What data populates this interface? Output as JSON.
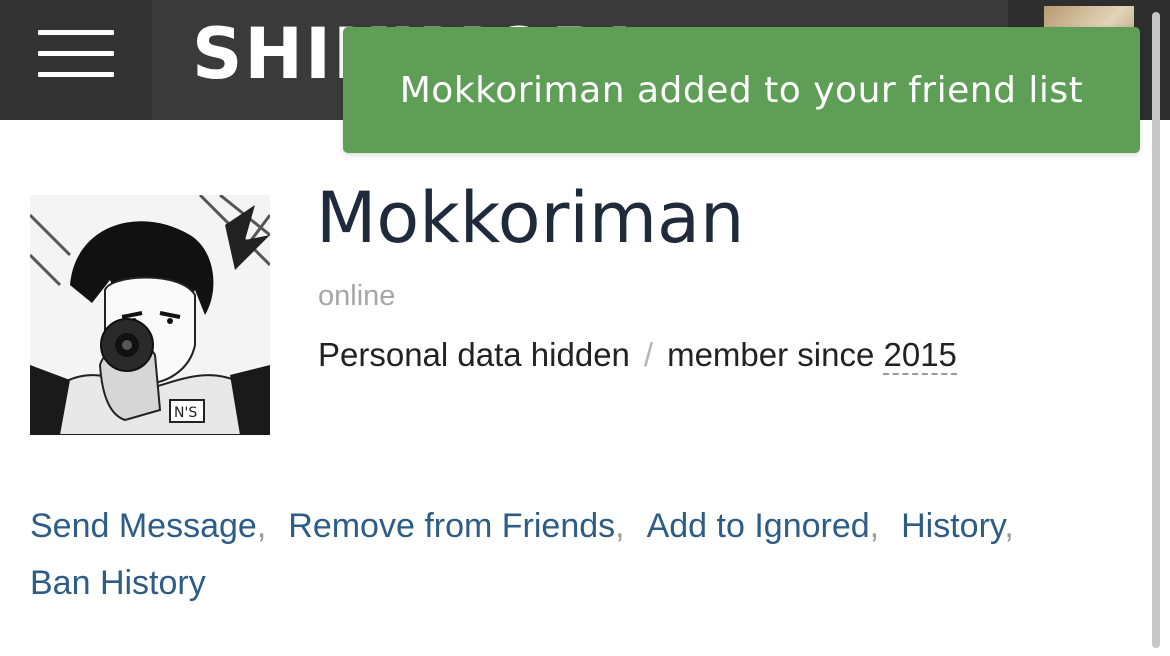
{
  "header": {
    "logo_text": "SHIKIMORI",
    "menu_icon": "hamburger-menu-icon"
  },
  "toast": {
    "message": "Mokkoriman added to your friend list",
    "background": "#5f9e56"
  },
  "profile": {
    "name": "Mokkoriman",
    "status": "online",
    "personal_data": "Personal data hidden",
    "separator": "/",
    "member_since_label": "member since",
    "member_since_year": "2015"
  },
  "actions": [
    {
      "label": "Send Message"
    },
    {
      "label": "Remove from Friends"
    },
    {
      "label": "Add to Ignored"
    },
    {
      "label": "History"
    },
    {
      "label": "Ban History"
    }
  ],
  "colors": {
    "topbar": "#3a3a3a",
    "link": "#2d5c86",
    "name": "#1f2a3a"
  }
}
